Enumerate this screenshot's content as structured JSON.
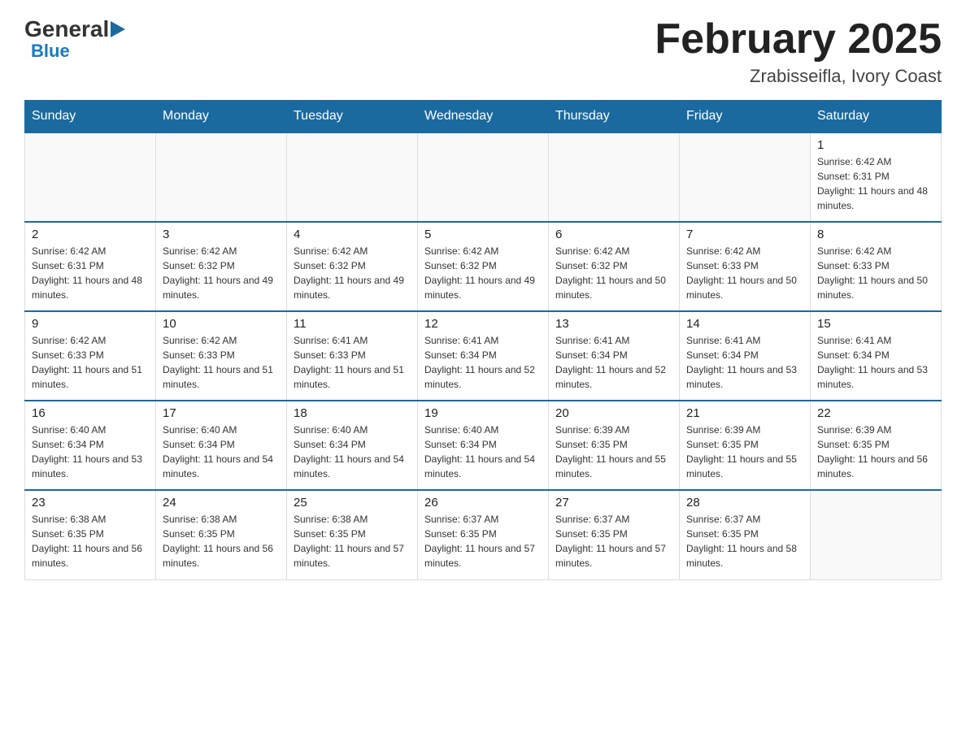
{
  "header": {
    "logo_general": "General",
    "logo_blue": "Blue",
    "month_title": "February 2025",
    "location": "Zrabisseifla, Ivory Coast"
  },
  "days_of_week": [
    "Sunday",
    "Monday",
    "Tuesday",
    "Wednesday",
    "Thursday",
    "Friday",
    "Saturday"
  ],
  "weeks": [
    [
      {
        "day": "",
        "sunrise": "",
        "sunset": "",
        "daylight": ""
      },
      {
        "day": "",
        "sunrise": "",
        "sunset": "",
        "daylight": ""
      },
      {
        "day": "",
        "sunrise": "",
        "sunset": "",
        "daylight": ""
      },
      {
        "day": "",
        "sunrise": "",
        "sunset": "",
        "daylight": ""
      },
      {
        "day": "",
        "sunrise": "",
        "sunset": "",
        "daylight": ""
      },
      {
        "day": "",
        "sunrise": "",
        "sunset": "",
        "daylight": ""
      },
      {
        "day": "1",
        "sunrise": "Sunrise: 6:42 AM",
        "sunset": "Sunset: 6:31 PM",
        "daylight": "Daylight: 11 hours and 48 minutes."
      }
    ],
    [
      {
        "day": "2",
        "sunrise": "Sunrise: 6:42 AM",
        "sunset": "Sunset: 6:31 PM",
        "daylight": "Daylight: 11 hours and 48 minutes."
      },
      {
        "day": "3",
        "sunrise": "Sunrise: 6:42 AM",
        "sunset": "Sunset: 6:32 PM",
        "daylight": "Daylight: 11 hours and 49 minutes."
      },
      {
        "day": "4",
        "sunrise": "Sunrise: 6:42 AM",
        "sunset": "Sunset: 6:32 PM",
        "daylight": "Daylight: 11 hours and 49 minutes."
      },
      {
        "day": "5",
        "sunrise": "Sunrise: 6:42 AM",
        "sunset": "Sunset: 6:32 PM",
        "daylight": "Daylight: 11 hours and 49 minutes."
      },
      {
        "day": "6",
        "sunrise": "Sunrise: 6:42 AM",
        "sunset": "Sunset: 6:32 PM",
        "daylight": "Daylight: 11 hours and 50 minutes."
      },
      {
        "day": "7",
        "sunrise": "Sunrise: 6:42 AM",
        "sunset": "Sunset: 6:33 PM",
        "daylight": "Daylight: 11 hours and 50 minutes."
      },
      {
        "day": "8",
        "sunrise": "Sunrise: 6:42 AM",
        "sunset": "Sunset: 6:33 PM",
        "daylight": "Daylight: 11 hours and 50 minutes."
      }
    ],
    [
      {
        "day": "9",
        "sunrise": "Sunrise: 6:42 AM",
        "sunset": "Sunset: 6:33 PM",
        "daylight": "Daylight: 11 hours and 51 minutes."
      },
      {
        "day": "10",
        "sunrise": "Sunrise: 6:42 AM",
        "sunset": "Sunset: 6:33 PM",
        "daylight": "Daylight: 11 hours and 51 minutes."
      },
      {
        "day": "11",
        "sunrise": "Sunrise: 6:41 AM",
        "sunset": "Sunset: 6:33 PM",
        "daylight": "Daylight: 11 hours and 51 minutes."
      },
      {
        "day": "12",
        "sunrise": "Sunrise: 6:41 AM",
        "sunset": "Sunset: 6:34 PM",
        "daylight": "Daylight: 11 hours and 52 minutes."
      },
      {
        "day": "13",
        "sunrise": "Sunrise: 6:41 AM",
        "sunset": "Sunset: 6:34 PM",
        "daylight": "Daylight: 11 hours and 52 minutes."
      },
      {
        "day": "14",
        "sunrise": "Sunrise: 6:41 AM",
        "sunset": "Sunset: 6:34 PM",
        "daylight": "Daylight: 11 hours and 53 minutes."
      },
      {
        "day": "15",
        "sunrise": "Sunrise: 6:41 AM",
        "sunset": "Sunset: 6:34 PM",
        "daylight": "Daylight: 11 hours and 53 minutes."
      }
    ],
    [
      {
        "day": "16",
        "sunrise": "Sunrise: 6:40 AM",
        "sunset": "Sunset: 6:34 PM",
        "daylight": "Daylight: 11 hours and 53 minutes."
      },
      {
        "day": "17",
        "sunrise": "Sunrise: 6:40 AM",
        "sunset": "Sunset: 6:34 PM",
        "daylight": "Daylight: 11 hours and 54 minutes."
      },
      {
        "day": "18",
        "sunrise": "Sunrise: 6:40 AM",
        "sunset": "Sunset: 6:34 PM",
        "daylight": "Daylight: 11 hours and 54 minutes."
      },
      {
        "day": "19",
        "sunrise": "Sunrise: 6:40 AM",
        "sunset": "Sunset: 6:34 PM",
        "daylight": "Daylight: 11 hours and 54 minutes."
      },
      {
        "day": "20",
        "sunrise": "Sunrise: 6:39 AM",
        "sunset": "Sunset: 6:35 PM",
        "daylight": "Daylight: 11 hours and 55 minutes."
      },
      {
        "day": "21",
        "sunrise": "Sunrise: 6:39 AM",
        "sunset": "Sunset: 6:35 PM",
        "daylight": "Daylight: 11 hours and 55 minutes."
      },
      {
        "day": "22",
        "sunrise": "Sunrise: 6:39 AM",
        "sunset": "Sunset: 6:35 PM",
        "daylight": "Daylight: 11 hours and 56 minutes."
      }
    ],
    [
      {
        "day": "23",
        "sunrise": "Sunrise: 6:38 AM",
        "sunset": "Sunset: 6:35 PM",
        "daylight": "Daylight: 11 hours and 56 minutes."
      },
      {
        "day": "24",
        "sunrise": "Sunrise: 6:38 AM",
        "sunset": "Sunset: 6:35 PM",
        "daylight": "Daylight: 11 hours and 56 minutes."
      },
      {
        "day": "25",
        "sunrise": "Sunrise: 6:38 AM",
        "sunset": "Sunset: 6:35 PM",
        "daylight": "Daylight: 11 hours and 57 minutes."
      },
      {
        "day": "26",
        "sunrise": "Sunrise: 6:37 AM",
        "sunset": "Sunset: 6:35 PM",
        "daylight": "Daylight: 11 hours and 57 minutes."
      },
      {
        "day": "27",
        "sunrise": "Sunrise: 6:37 AM",
        "sunset": "Sunset: 6:35 PM",
        "daylight": "Daylight: 11 hours and 57 minutes."
      },
      {
        "day": "28",
        "sunrise": "Sunrise: 6:37 AM",
        "sunset": "Sunset: 6:35 PM",
        "daylight": "Daylight: 11 hours and 58 minutes."
      },
      {
        "day": "",
        "sunrise": "",
        "sunset": "",
        "daylight": ""
      }
    ]
  ]
}
